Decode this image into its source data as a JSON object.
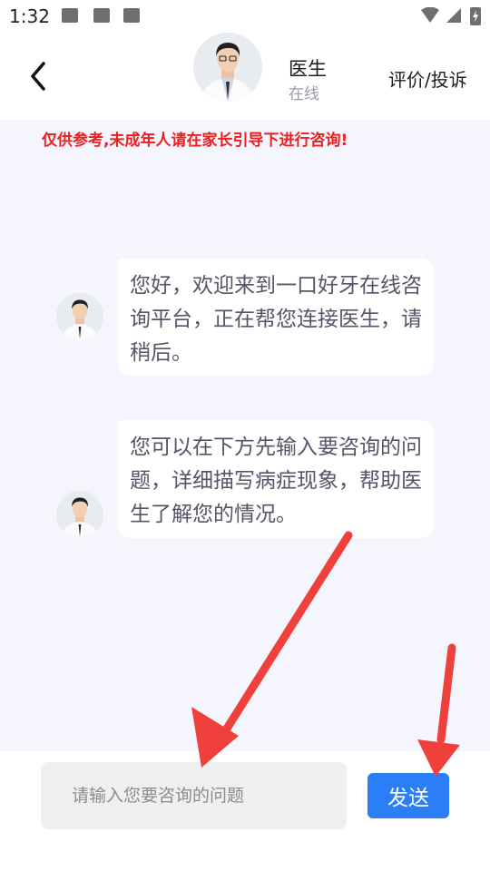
{
  "status_bar": {
    "time": "1:32"
  },
  "header": {
    "doctor_name": "医生",
    "doctor_status": "在线",
    "review_link": "评价/投诉"
  },
  "chat": {
    "notice": "仅供参考,未成年人请在家长引导下进行咨询!",
    "messages": [
      {
        "text": "您好，欢迎来到一口好牙在线咨询平台，正在帮您连接医生，请稍后。"
      },
      {
        "text": "您可以在下方先输入要咨询的问题，详细描写病症现象，帮助医生了解您的情况。"
      }
    ]
  },
  "input_bar": {
    "placeholder": "请输入您要咨询的问题",
    "send_label": "发送"
  },
  "colors": {
    "accent": "#2b7ef5",
    "annotation_arrow": "#f0403c",
    "notice": "#ef1e1e"
  }
}
